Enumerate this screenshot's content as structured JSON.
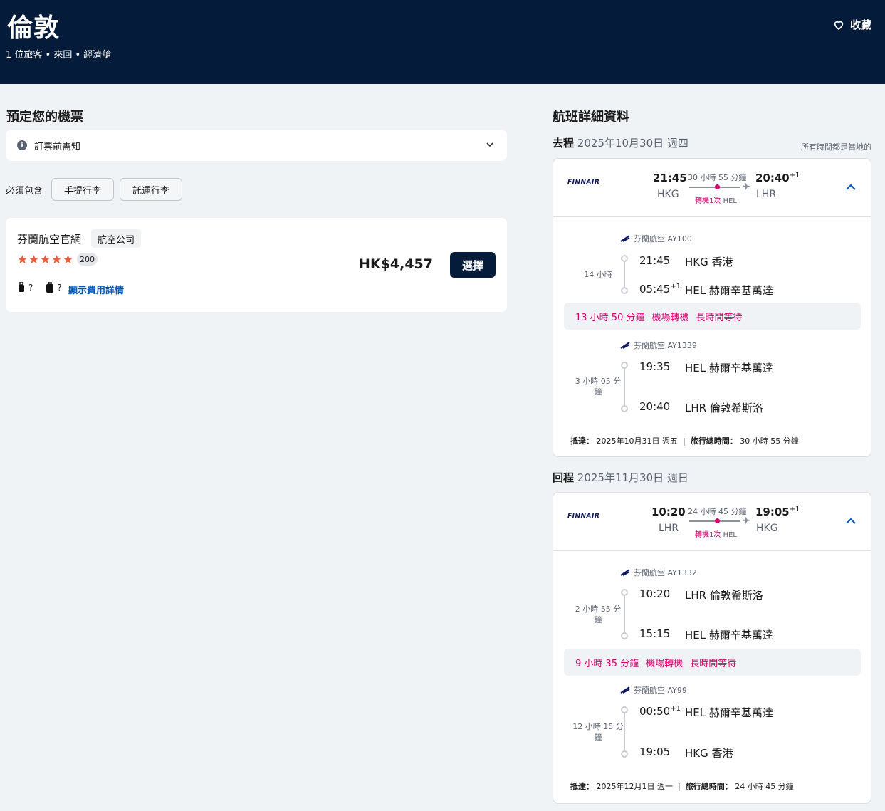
{
  "header": {
    "title": "倫敦",
    "subtitle": "1 位旅客 • 來回 • 經濟艙",
    "save_label": "收藏"
  },
  "booking": {
    "title": "預定您的機票",
    "notice_label": "訂票前需知",
    "include_label": "必須包含",
    "chips": [
      "手提行李",
      "託運行李"
    ]
  },
  "offer": {
    "provider": "芬蘭航空官網",
    "badge": "航空公司",
    "stars": 5,
    "rating_count": "200",
    "bag_cabin": "?",
    "bag_checked": "?",
    "fee_link": "顯示費用詳情",
    "price": "HK$4,457",
    "select_label": "選擇"
  },
  "details": {
    "title": "航班詳細資料",
    "tz_note": "所有時間都是當地的",
    "airline_logo": "FINNAIR",
    "outbound": {
      "label": "去程",
      "date": "2025年10月30日 週四",
      "dep_time": "21:45",
      "dep_code": "HKG",
      "arr_time": "20:40",
      "arr_plus": "+1",
      "arr_code": "LHR",
      "duration": "30 小時 55 分鐘",
      "stops": "轉機1次",
      "stop_code": "HEL",
      "seg1": {
        "airline": "芬蘭航空 AY100",
        "duration": "14 小時",
        "dep_time": "21:45",
        "dep_place": "HKG 香港",
        "arr_time": "05:45",
        "arr_plus": "+1",
        "arr_place": "HEL 赫爾辛基萬達"
      },
      "layover": [
        "13 小時 50 分鐘",
        "機場轉機",
        "長時間等待"
      ],
      "seg2": {
        "airline": "芬蘭航空 AY1339",
        "duration": "3 小時 05 分鐘",
        "dep_time": "19:35",
        "dep_place": "HEL 赫爾辛基萬達",
        "arr_time": "20:40",
        "arr_place": "LHR 倫敦希斯洛"
      },
      "arrive_label": "抵達：",
      "arrive_date": "2025年10月31日 週五",
      "total_label": "旅行總時間：",
      "total": "30 小時 55 分鐘"
    },
    "inbound": {
      "label": "回程",
      "date": "2025年11月30日 週日",
      "dep_time": "10:20",
      "dep_code": "LHR",
      "arr_time": "19:05",
      "arr_plus": "+1",
      "arr_code": "HKG",
      "duration": "24 小時 45 分鐘",
      "stops": "轉機1次",
      "stop_code": "HEL",
      "seg1": {
        "airline": "芬蘭航空 AY1332",
        "duration": "2 小時 55 分鐘",
        "dep_time": "10:20",
        "dep_place": "LHR 倫敦希斯洛",
        "arr_time": "15:15",
        "arr_place": "HEL 赫爾辛基萬達"
      },
      "layover": [
        "9 小時 35 分鐘",
        "機場轉機",
        "長時間等待"
      ],
      "seg2": {
        "airline": "芬蘭航空 AY99",
        "duration": "12 小時 15 分鐘",
        "dep_time": "00:50",
        "dep_plus": "+1",
        "dep_place": "HEL 赫爾辛基萬達",
        "arr_time": "19:05",
        "arr_place": "HKG 香港"
      },
      "arrive_label": "抵達：",
      "arrive_date": "2025年12月1日 週一",
      "total_label": "旅行總時間：",
      "total": "24 小時 45 分鐘"
    }
  },
  "colors": {
    "header_bg": "#041c3a",
    "accent_pink": "#d6006e",
    "link_blue": "#0057b8",
    "star": "#ec5a38"
  }
}
